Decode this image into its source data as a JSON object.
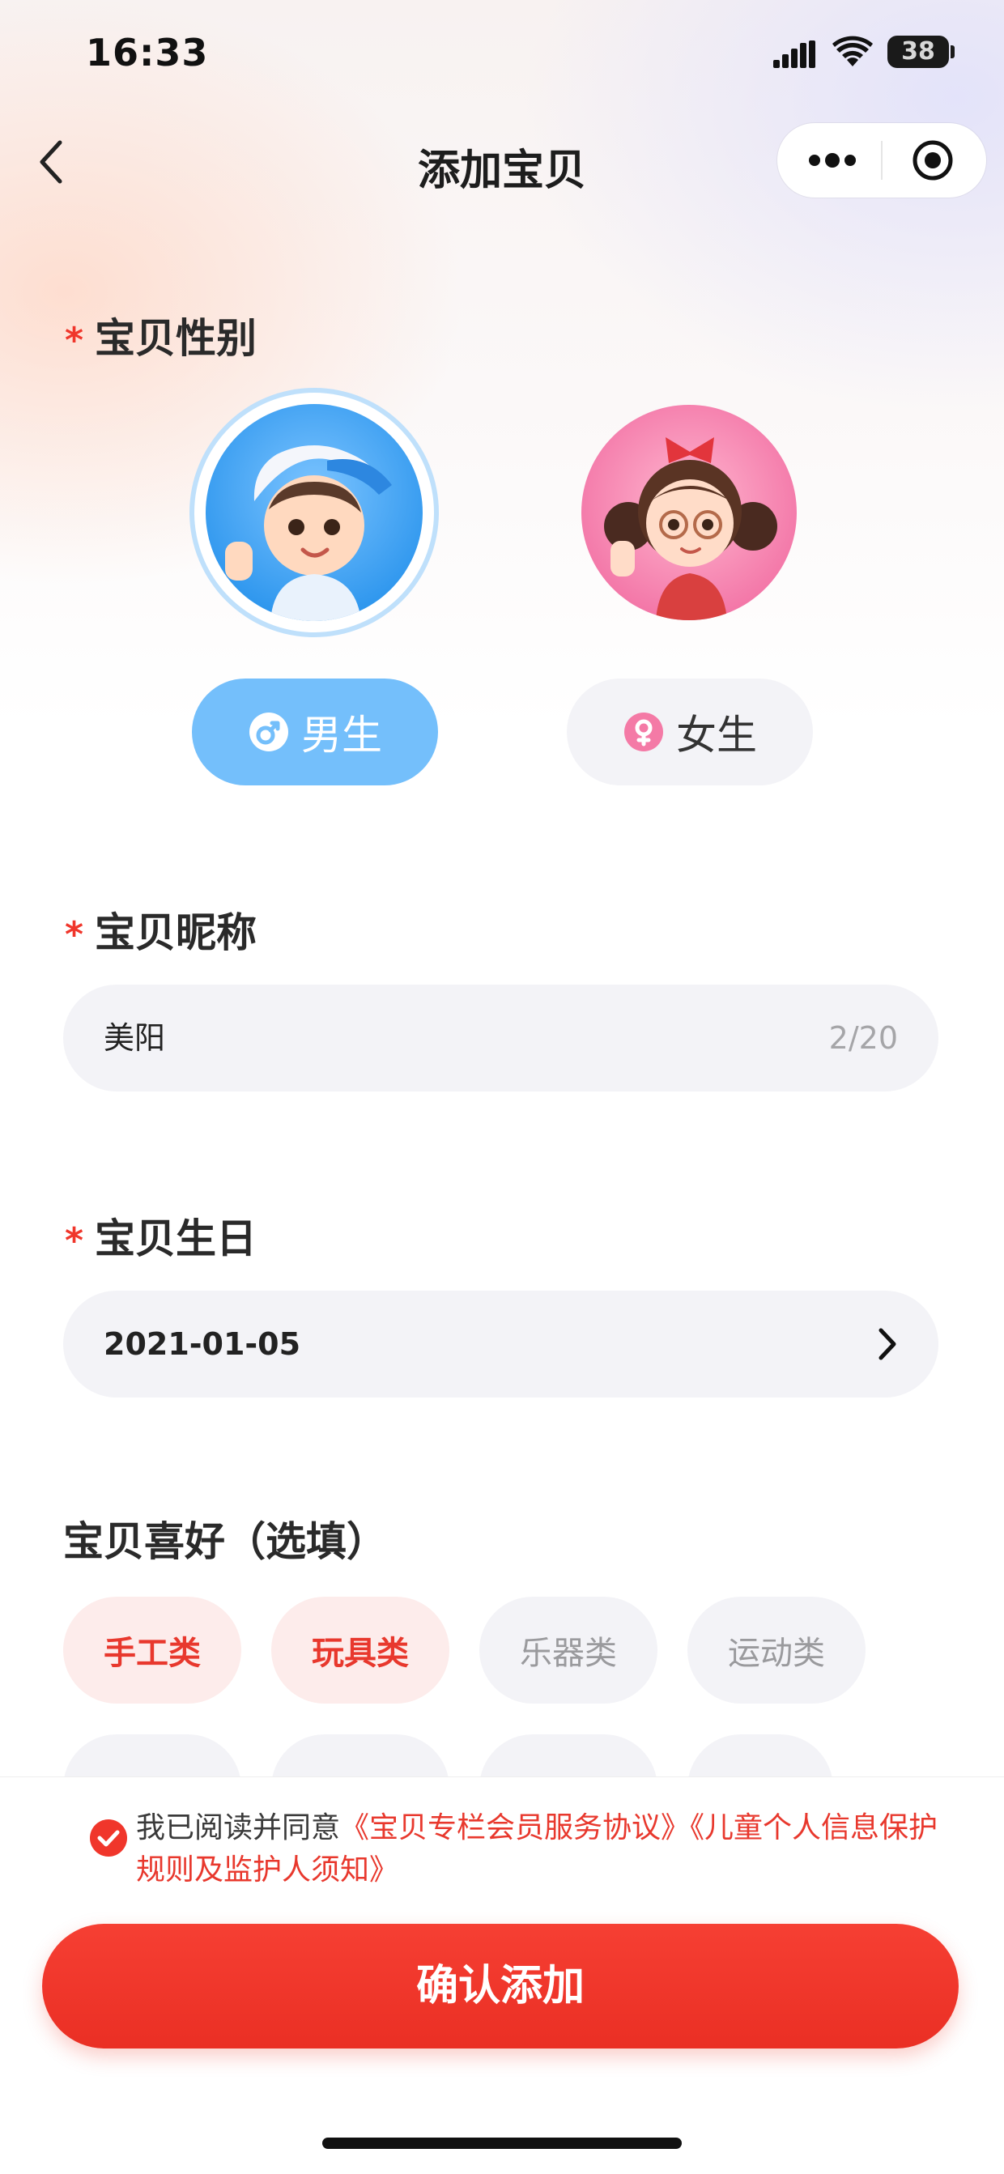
{
  "status_bar": {
    "time": "16:33",
    "battery": "38"
  },
  "nav": {
    "title": "添加宝贝"
  },
  "gender_section": {
    "required_mark": "*",
    "label": "宝贝性别",
    "options": [
      {
        "label": "男生",
        "selected": true,
        "color": "#74bffb"
      },
      {
        "label": "女生",
        "selected": false,
        "color": "#f3f3f7"
      }
    ]
  },
  "nickname_section": {
    "required_mark": "*",
    "label": "宝贝昵称",
    "value": "美阳",
    "count": "2/20"
  },
  "birthday_section": {
    "required_mark": "*",
    "label": "宝贝生日",
    "value": "2021-01-05"
  },
  "hobby_section": {
    "label": "宝贝喜好（选填）",
    "chips": [
      {
        "label": "手工类",
        "selected": true
      },
      {
        "label": "玩具类",
        "selected": true
      },
      {
        "label": "乐器类",
        "selected": false
      },
      {
        "label": "运动类",
        "selected": false
      }
    ]
  },
  "agreement": {
    "checked": true,
    "prefix": "我已阅读并同意",
    "link1": "《宝贝专栏会员服务协议》",
    "link2": "《儿童个人信息保护规则及监护人须知》"
  },
  "confirm_button": {
    "label": "确认添加"
  },
  "colors": {
    "accent_red": "#f0362b",
    "male_blue": "#74bffb",
    "chip_bg": "#f3f3f7"
  }
}
